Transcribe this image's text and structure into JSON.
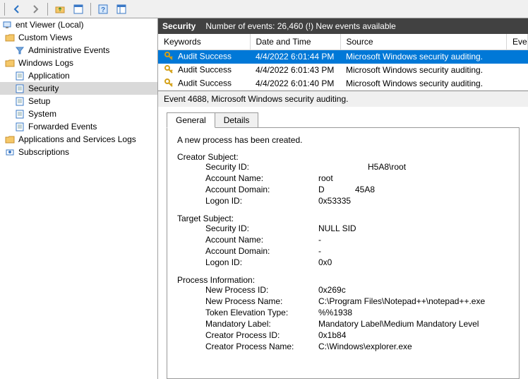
{
  "toolbar": {
    "icons": [
      "back-arrow-icon",
      "forward-arrow-icon",
      "folder-up-icon",
      "properties-icon",
      "help-icon",
      "panes-icon"
    ]
  },
  "tree": {
    "root": "ent Viewer (Local)",
    "items": [
      {
        "label": "Custom Views",
        "icon": "folder",
        "level": 1
      },
      {
        "label": "Administrative Events",
        "icon": "filter",
        "level": 2
      },
      {
        "label": "Windows Logs",
        "icon": "folder",
        "level": 1
      },
      {
        "label": "Application",
        "icon": "log",
        "level": 2
      },
      {
        "label": "Security",
        "icon": "log",
        "level": 2,
        "selected": true
      },
      {
        "label": "Setup",
        "icon": "log",
        "level": 2
      },
      {
        "label": "System",
        "icon": "log",
        "level": 2
      },
      {
        "label": "Forwarded Events",
        "icon": "log",
        "level": 2
      },
      {
        "label": "Applications and Services Logs",
        "icon": "folder",
        "level": 1
      },
      {
        "label": "Subscriptions",
        "icon": "subs",
        "level": 1
      }
    ]
  },
  "header": {
    "title": "Security",
    "count_label": "Number of events: 26,460 (!) New events available"
  },
  "columns": {
    "keywords": "Keywords",
    "datetime": "Date and Time",
    "source": "Source",
    "eventid": "Eve"
  },
  "rows": [
    {
      "kw": "Audit Success",
      "dt": "4/4/2022 6:01:44 PM",
      "src": "Microsoft Windows security auditing.",
      "selected": true
    },
    {
      "kw": "Audit Success",
      "dt": "4/4/2022 6:01:43 PM",
      "src": "Microsoft Windows security auditing."
    },
    {
      "kw": "Audit Success",
      "dt": "4/4/2022 6:01:40 PM",
      "src": "Microsoft Windows security auditing."
    }
  ],
  "event_title": "Event 4688, Microsoft Windows security auditing.",
  "tabs": {
    "general": "General",
    "details": "Details"
  },
  "body": {
    "intro": "A new process has been created.",
    "creator_head": "Creator Subject:",
    "creator": {
      "sid_l": "Security ID:",
      "sid_v": "H5A8\\root",
      "an_l": "Account Name:",
      "an_v": "root",
      "ad_l": "Account Domain:",
      "ad_v": "D             45A8",
      "li_l": "Logon ID:",
      "li_v": "0x53335"
    },
    "target_head": "Target Subject:",
    "target": {
      "sid_l": "Security ID:",
      "sid_v": "NULL SID",
      "an_l": "Account Name:",
      "an_v": "-",
      "ad_l": "Account Domain:",
      "ad_v": "-",
      "li_l": "Logon ID:",
      "li_v": "0x0"
    },
    "proc_head": "Process Information:",
    "proc": {
      "npid_l": "New Process ID:",
      "npid_v": "0x269c",
      "npn_l": "New Process Name:",
      "npn_v": "C:\\Program Files\\Notepad++\\notepad++.exe",
      "tet_l": "Token Elevation Type:",
      "tet_v": "%%1938",
      "ml_l": "Mandatory Label:",
      "ml_v": "Mandatory Label\\Medium Mandatory Level",
      "cpid_l": "Creator Process ID:",
      "cpid_v": "0x1b84",
      "cpn_l": "Creator Process Name:",
      "cpn_v": "C:\\Windows\\explorer.exe"
    }
  }
}
